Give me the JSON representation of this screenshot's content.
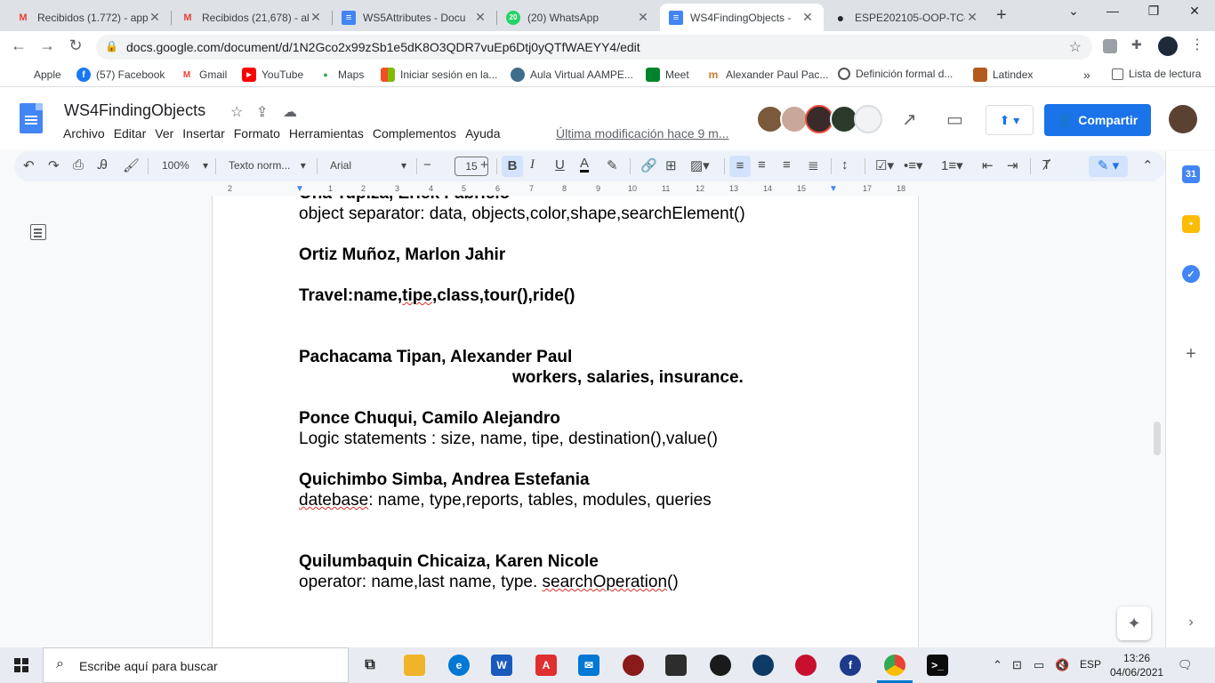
{
  "browser": {
    "tabs": [
      {
        "title": "Recibidos (1.772) - app",
        "icon": "gmail-icon",
        "color": "#ea4335",
        "letter": "M"
      },
      {
        "title": "Recibidos (21,678) - al",
        "icon": "gmail-icon",
        "color": "#ea4335",
        "letter": "M"
      },
      {
        "title": "WS5Attributes - Docu",
        "icon": "docs-icon",
        "color": "#4285f4",
        "letter": "≡"
      },
      {
        "title": "(20) WhatsApp",
        "icon": "whatsapp-icon",
        "color": "#25d366",
        "letter": "20"
      },
      {
        "title": "WS4FindingObjects - ",
        "icon": "docs-icon",
        "color": "#4285f4",
        "letter": "≡"
      },
      {
        "title": "ESPE202105-OOP-TC-",
        "icon": "github-icon",
        "color": "#24292e",
        "letter": "●"
      }
    ],
    "url": "docs.google.com/document/d/1N2Gco2x99zSb1e5dK8O3QDR7vuEp6Dtj0yQTfWAEYY4/edit",
    "bookmarks": [
      {
        "label": "Apple",
        "color": "#555555",
        "letter": ""
      },
      {
        "label": "(57) Facebook",
        "color": "#1877f2",
        "letter": "f"
      },
      {
        "label": "Gmail",
        "color": "#ea4335",
        "letter": "M"
      },
      {
        "label": "YouTube",
        "color": "#ff0000",
        "letter": "▶"
      },
      {
        "label": "Maps",
        "color": "#34a853",
        "letter": "•"
      },
      {
        "label": "Iniciar sesión en la...",
        "color": "#f25022",
        "letter": ""
      },
      {
        "label": "Aula Virtual AAMPE...",
        "color": "#3f6e8c",
        "letter": ""
      },
      {
        "label": "Meet",
        "color": "#00832d",
        "letter": ""
      },
      {
        "label": "Alexander Paul Pac...",
        "color": "#c97a2a",
        "letter": "m"
      },
      {
        "label": "Definición formal d...",
        "color": "#555555",
        "letter": ""
      },
      {
        "label": "Latindex",
        "color": "#b35a1f",
        "letter": ""
      }
    ],
    "more_bookmarks": "»",
    "reading_list": "Lista de lectura"
  },
  "docs": {
    "title": "WS4FindingObjects",
    "menu": [
      "Archivo",
      "Editar",
      "Ver",
      "Insertar",
      "Formato",
      "Herramientas",
      "Complementos",
      "Ayuda"
    ],
    "last_modified": "Última modificación hace 9 m...",
    "share_label": "Compartir",
    "toolbar": {
      "zoom": "100%",
      "style": "Texto norm...",
      "font": "Arial",
      "size": "15"
    },
    "ruler_ticks": [
      "2",
      "1",
      "1",
      "2",
      "3",
      "4",
      "5",
      "6",
      "7",
      "8",
      "9",
      "10",
      "11",
      "12",
      "13",
      "14",
      "15",
      "16",
      "17",
      "18"
    ]
  },
  "document": {
    "lines": [
      {
        "text": "Oña Tupiza, Erick Fabricio",
        "bold": true
      },
      {
        "text": "object separator: data, objects,color,shape,searchElement()",
        "bold": false
      },
      {
        "text": "Ortiz Muñoz, Marlon Jahir",
        "bold": true
      },
      {
        "text_pre": "Travel:name,",
        "text_squig": "tipe",
        "text_post": ",class,tour(),ride()",
        "bold": true
      },
      {
        "text": "Pachacama Tipan, Alexander Paul",
        "bold": true
      },
      {
        "text": "workers, salaries, insurance.",
        "bold": true
      },
      {
        "text": "Ponce Chuqui, Camilo Alejandro",
        "bold": true
      },
      {
        "text": "Logic statements : size, name, tipe, destination(),value()",
        "bold": false
      },
      {
        "text": "Quichimbo Simba, Andrea Estefania",
        "bold": true
      },
      {
        "text_squig": "datebase",
        "text_post": ": name, type,reports, tables, modules, queries",
        "bold": false
      },
      {
        "text": "Quilumbaquin Chicaiza, Karen Nicole",
        "bold": true
      },
      {
        "text_pre": "operator: name,last name, type. ",
        "text_squig": "searchOperation",
        "text_post": "()",
        "bold": false
      }
    ]
  },
  "taskbar": {
    "search_placeholder": "Escribe aquí para buscar",
    "lang": "ESP",
    "time": "13:26",
    "date": "04/06/2021"
  }
}
